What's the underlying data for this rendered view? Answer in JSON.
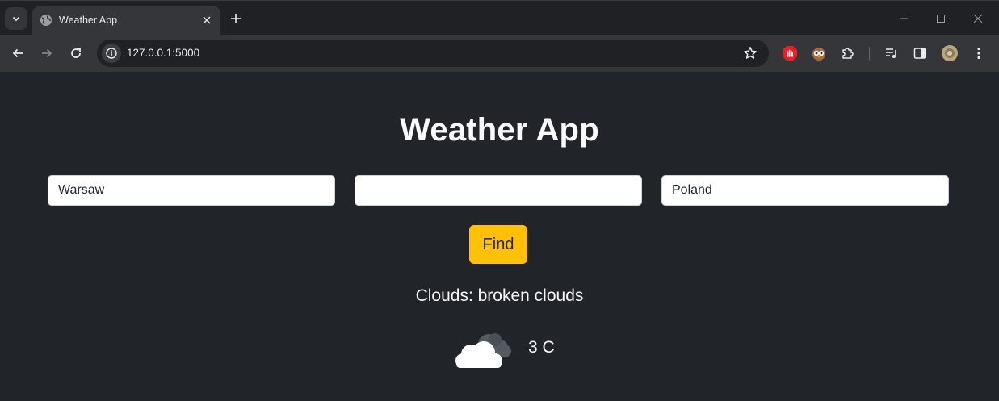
{
  "browser": {
    "tab_title": "Weather App",
    "url": "127.0.0.1:5000",
    "icons": {
      "tab_search": "chevron-down-icon",
      "favicon": "globe-icon",
      "tab_close": "close-icon",
      "new_tab": "plus-icon",
      "minimize": "minimize-icon",
      "maximize": "maximize-icon",
      "close_window": "close-icon",
      "back": "back-arrow-icon",
      "forward": "forward-arrow-icon",
      "reload": "reload-icon",
      "site_info": "info-icon",
      "bookmark": "star-icon",
      "extensions": [
        "adblock-icon",
        "owl-extension-icon",
        "puzzle-icon",
        "media-playlist-icon",
        "side-panel-icon",
        "profile-avatar-icon",
        "more-menu-icon"
      ]
    }
  },
  "page": {
    "title": "Weather App",
    "fields": {
      "city": {
        "value": "Warsaw",
        "placeholder": ""
      },
      "state": {
        "value": "",
        "placeholder": ""
      },
      "country": {
        "value": "Poland",
        "placeholder": ""
      }
    },
    "find_label": "Find",
    "condition": "Clouds: broken clouds",
    "temperature": "3 C",
    "weather_icon": "broken-clouds-icon"
  },
  "colors": {
    "page_bg": "#212529",
    "accent_button": "#ffc107",
    "text_light": "#f8f9fa"
  }
}
